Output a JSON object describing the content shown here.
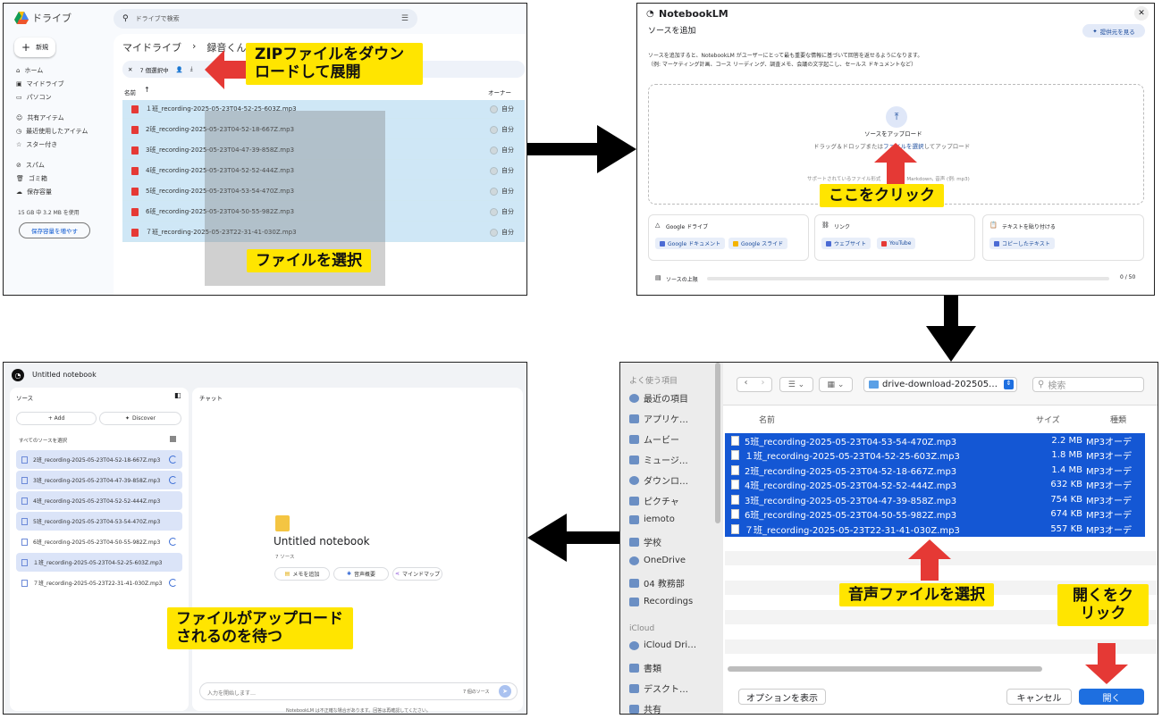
{
  "colors": {
    "callout": "#ffe500",
    "arrow_red": "#e53935",
    "selection_blue": "#1457d4",
    "drive_highlight": "#cfe7f6"
  },
  "drive": {
    "app_name": "ドライブ",
    "search_placeholder": "ドライブで検索",
    "new_button": "新規",
    "nav": [
      "ホーム",
      "マイドライブ",
      "パソコン",
      "共有アイテム",
      "最近使用したアイテム",
      "スター付き",
      "スパム",
      "ゴミ箱",
      "保存容量"
    ],
    "storage_text": "15 GB 中 3.2 MB を使用",
    "storage_button": "保存容量を増やす",
    "breadcrumb_root": "マイドライブ",
    "breadcrumb_sep": "›",
    "breadcrumb_folder": "録音くん個別…",
    "selected_count": "7 個選択中",
    "col_name": "名前",
    "col_owner": "オーナー",
    "owner_value": "自分",
    "files": [
      "１班_recording-2025-05-23T04-52-25-603Z.mp3",
      "2班_recording-2025-05-23T04-52-18-667Z.mp3",
      "3班_recording-2025-05-23T04-47-39-858Z.mp3",
      "4班_recording-2025-05-23T04-52-52-444Z.mp3",
      "5班_recording-2025-05-23T04-53-54-470Z.mp3",
      "6班_recording-2025-05-23T04-50-55-982Z.mp3",
      "７班_recording-2025-05-23T22-31-41-030Z.mp3"
    ]
  },
  "notebooklm": {
    "brand": "NotebookLM",
    "dialog_title": "ソースを追加",
    "discover_button": "提供元を見る",
    "description_line1": "ソースを追加すると、NotebookLM がユーザーにとって最も重要な情報に基づいて回答を返せるようになります。",
    "description_line2": "（例: マーケティング計画、コース リーディング、調査メモ、会議の文字起こし、セールス ドキュメントなど）",
    "upload_title": "ソースをアップロード",
    "upload_sub_before": "ドラッグ＆ドロップまたは",
    "upload_sub_link": "ファイルを選択",
    "upload_sub_after": "してアップロード",
    "supported_before": "サポートされているファイル形式",
    "supported_after": "txt, Markdown, 音声 (例: mp3)",
    "gdrive_title": "Google ドライブ",
    "gdrive_chips": [
      "Google ドキュメント",
      "Google スライド"
    ],
    "link_title": "リンク",
    "link_chips": [
      "ウェブサイト",
      "YouTube"
    ],
    "paste_title": "テキストを貼り付ける",
    "paste_chips": [
      "コピーしたテキスト"
    ],
    "limit_label": "ソースの上限",
    "limit_count": "0 / 50"
  },
  "finder": {
    "sidebar_header": "よく使う項目",
    "sidebar_items": [
      "最近の項目",
      "アプリケ…",
      "ムービー",
      "ミュージ…",
      "ダウンロ…",
      "ピクチャ",
      "iemoto",
      "学校",
      "OneDrive",
      "04 教務部",
      "Recordings"
    ],
    "icloud_header": "iCloud",
    "icloud_items": [
      "iCloud Dri…",
      "書類",
      "デスクト…",
      "共有"
    ],
    "folder": "drive-download-202505…",
    "search_placeholder": "検索",
    "col_name": "名前",
    "col_size": "サイズ",
    "col_kind": "種類",
    "kind_value": "MP3オーデ",
    "files": [
      {
        "name": "5班_recording-2025-05-23T04-53-54-470Z.mp3",
        "size": "2.2 MB"
      },
      {
        "name": "１班_recording-2025-05-23T04-52-25-603Z.mp3",
        "size": "1.8 MB"
      },
      {
        "name": "2班_recording-2025-05-23T04-52-18-667Z.mp3",
        "size": "1.4 MB"
      },
      {
        "name": "4班_recording-2025-05-23T04-52-52-444Z.mp3",
        "size": "632 KB"
      },
      {
        "name": "3班_recording-2025-05-23T04-47-39-858Z.mp3",
        "size": "754 KB"
      },
      {
        "name": "6班_recording-2025-05-23T04-50-55-982Z.mp3",
        "size": "674 KB"
      },
      {
        "name": "７班_recording-2025-05-23T22-31-41-030Z.mp3",
        "size": "557 KB"
      }
    ],
    "options_button": "オプションを表示",
    "cancel_button": "キャンセル",
    "open_button": "開く"
  },
  "notebook": {
    "title": "Untitled notebook",
    "sources_header": "ソース",
    "chat_header": "チャット",
    "add_button": "+ Add",
    "discover_button": "Discover",
    "select_all": "すべてのソースを選択",
    "sources": [
      "2班_recording-2025-05-23T04-52-18-667Z.mp3",
      "3班_recording-2025-05-23T04-47-39-858Z.mp3",
      "4班_recording-2025-05-23T04-52-52-444Z.mp3",
      "5班_recording-2025-05-23T04-53-54-470Z.mp3",
      "6班_recording-2025-05-23T04-50-55-982Z.mp3",
      "１班_recording-2025-05-23T04-52-25-603Z.mp3",
      "７班_recording-2025-05-23T22-31-41-030Z.mp3"
    ],
    "notebook_title": "Untitled notebook",
    "source_count": "7 ソース",
    "actions": [
      "メモを追加",
      "音声概要",
      "マインドマップ"
    ],
    "input_placeholder": "入力を開始します…",
    "input_count": "7 個のソース",
    "footer": "NotebookLM は不正確な場合があります。回答は再確認してください。"
  },
  "callouts": {
    "zip": "ZIPファイルをダウンロードして展開",
    "select_file": "ファイルを選択",
    "click_here": "ここをクリック",
    "select_audio": "音声ファイルを選択",
    "click_open": "開くをクリック",
    "wait_upload": "ファイルがアップロードされるのを待つ"
  }
}
